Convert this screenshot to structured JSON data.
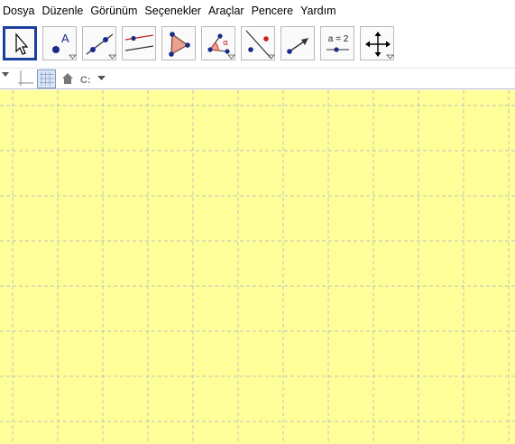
{
  "menubar": {
    "items": [
      "Dosya",
      "Düzenle",
      "Görünüm",
      "Seçenekler",
      "Araçlar",
      "Pencere",
      "Yardım"
    ]
  },
  "toolbar": {
    "tools": [
      {
        "icon": "move-arrow-icon",
        "selected": true
      },
      {
        "icon": "point-icon",
        "label": "A"
      },
      {
        "icon": "line-through-two-points-icon"
      },
      {
        "icon": "perpendicular-line-icon"
      },
      {
        "icon": "polygon-icon"
      },
      {
        "icon": "angle-icon",
        "label": "α"
      },
      {
        "icon": "reflect-about-line-icon"
      },
      {
        "icon": "vector-icon"
      },
      {
        "icon": "slider-icon",
        "label": "a = 2"
      },
      {
        "icon": "move-graphics-view-icon"
      }
    ]
  },
  "stylebar": {
    "items": [
      "stylebar-toggle-icon",
      "show-axes-icon",
      "show-grid-icon",
      "standard-view-home-icon",
      "point-capturing-icon"
    ],
    "capture_label": "C:"
  },
  "graphics": {
    "background_color": "#ffff99",
    "grid": true,
    "grid_color": "#c0c0c0",
    "axes": false
  }
}
